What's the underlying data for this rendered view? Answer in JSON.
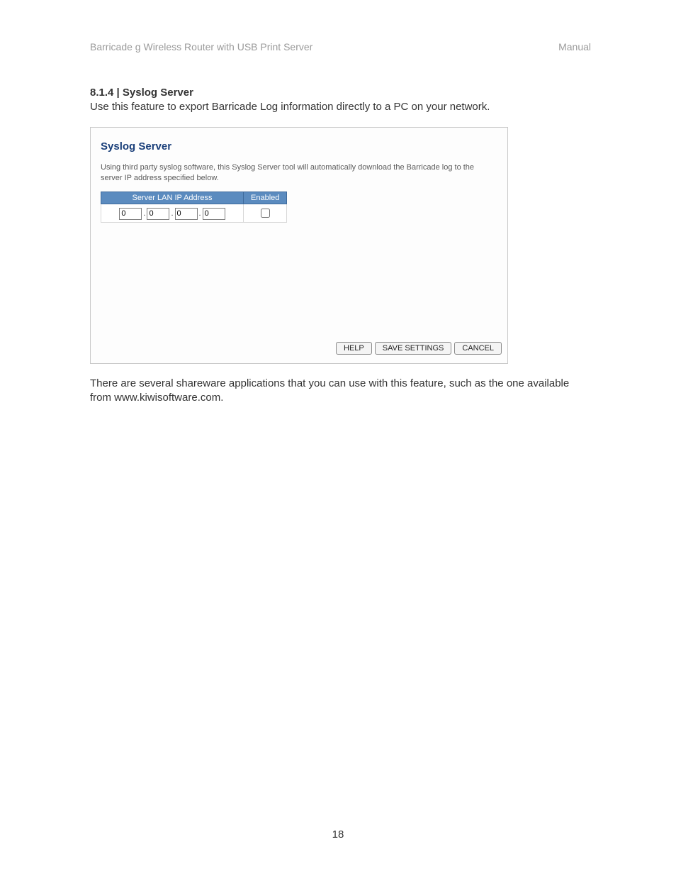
{
  "header": {
    "left": "Barricade g Wireless Router with USB Print Server",
    "right": "Manual"
  },
  "section": {
    "title": "8.1.4 | Syslog Server",
    "description": "Use this feature to export Barricade Log information directly to a PC on your network."
  },
  "panel": {
    "title": "Syslog Server",
    "description": "Using third party syslog software, this Syslog Server tool will automatically download the Barricade log to the server IP address specified below.",
    "columns": {
      "ip": "Server LAN IP Address",
      "enabled": "Enabled"
    },
    "ip": {
      "a": "0",
      "b": "0",
      "c": "0",
      "d": "0"
    },
    "enabled": false,
    "buttons": {
      "help": "HELP",
      "save": "SAVE SETTINGS",
      "cancel": "CANCEL"
    }
  },
  "after_text": "There are several shareware applications that you can use with this feature, such as the one available from www.kiwisoftware.com.",
  "page_number": "18"
}
